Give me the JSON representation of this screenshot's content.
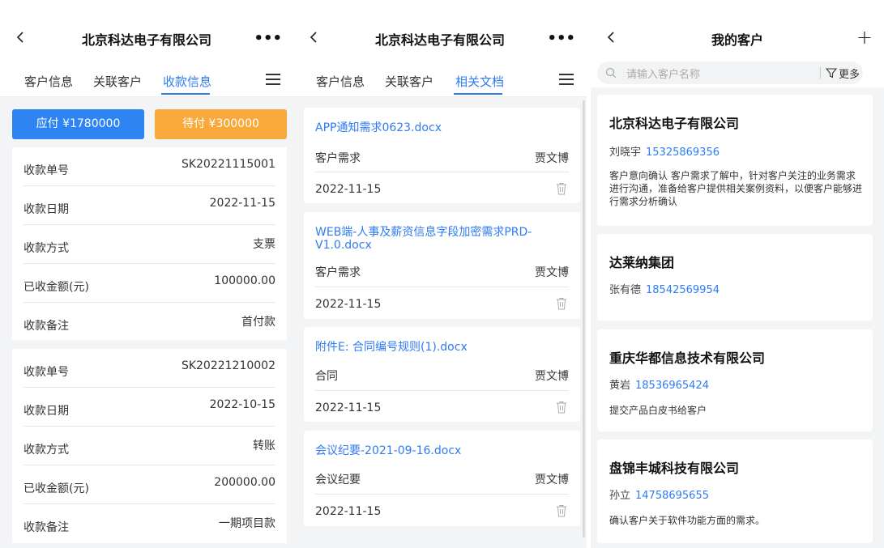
{
  "screen1": {
    "title": "北京科达电子有限公司",
    "more": "•••",
    "tabs": [
      "客户信息",
      "关联客户",
      "收款信息"
    ],
    "payable": "应付 ¥1780000",
    "pending": "待付 ¥300000",
    "records": [
      {
        "rows": [
          {
            "label": "收款单号",
            "value": "SK20221115001"
          },
          {
            "label": "收款日期",
            "value": "2022-11-15"
          },
          {
            "label": "收款方式",
            "value": "支票"
          },
          {
            "label": "已收金额(元)",
            "value": "100000.00"
          },
          {
            "label": "收款备注",
            "value": "首付款"
          }
        ]
      },
      {
        "rows": [
          {
            "label": "收款单号",
            "value": "SK20221210002"
          },
          {
            "label": "收款日期",
            "value": "2022-10-15"
          },
          {
            "label": "收款方式",
            "value": "转账"
          },
          {
            "label": "已收金额(元)",
            "value": "200000.00"
          },
          {
            "label": "收款备注",
            "value": "一期项目款"
          }
        ]
      }
    ]
  },
  "screen2": {
    "title": "北京科达电子有限公司",
    "more": "•••",
    "tabs": [
      "客户信息",
      "关联客户",
      "相关文档"
    ],
    "docs": [
      {
        "name": "APP通知需求0623.docx",
        "type": "客户需求",
        "author": "贾文博",
        "date": "2022-11-15"
      },
      {
        "name": "WEB端-人事及薪资信息字段加密需求PRD-V1.0.docx",
        "type": "客户需求",
        "author": "贾文博",
        "date": "2022-11-15"
      },
      {
        "name": "附件E: 合同编号规则(1).docx",
        "type": "合同",
        "author": "贾文博",
        "date": "2022-11-15"
      },
      {
        "name": "会议纪要-2021-09-16.docx",
        "type": "会议纪要",
        "author": "贾文博",
        "date": "2022-11-15"
      }
    ]
  },
  "screen3": {
    "title": "我的客户",
    "plus": "+",
    "search_placeholder": "请输入客户名称",
    "filter_label": "更多",
    "customers": [
      {
        "name": "北京科达电子有限公司",
        "contact": "刘晓宇",
        "phone": "15325869356",
        "note": "客户意向确认 客户需求了解中，针对客户关注的业务需求进行沟通，准备给客户提供相关案例资料，以便客户能够进行需求分析确认"
      },
      {
        "name": "达莱纳集团",
        "contact": "张有德",
        "phone": "18542569954",
        "note": ""
      },
      {
        "name": "重庆华都信息技术有限公司",
        "contact": "黄岩",
        "phone": "18536965424",
        "note": "提交产品白皮书给客户"
      },
      {
        "name": "盘锦丰城科技有限公司",
        "contact": "孙立",
        "phone": "14758695655",
        "note": "确认客户关于软件功能方面的需求。"
      }
    ]
  },
  "colors": {
    "accent": "#2f7bf3",
    "orange": "#f9a93a",
    "blue_button": "#2f84f3"
  }
}
